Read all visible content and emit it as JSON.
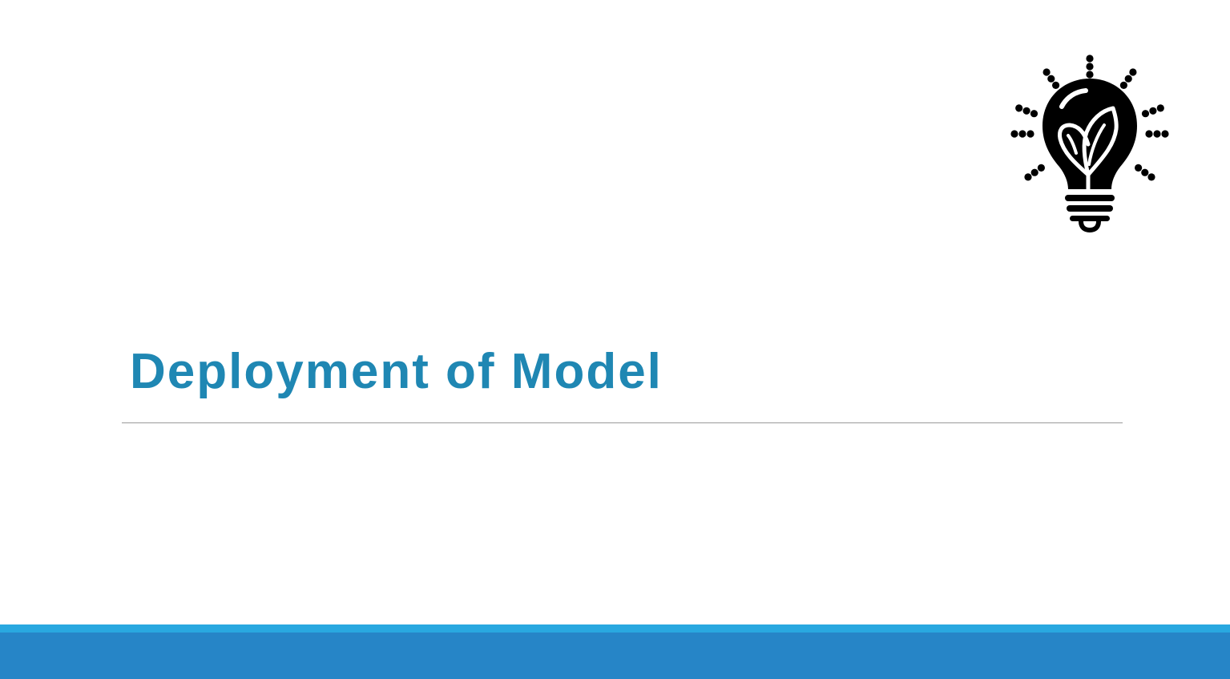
{
  "slide": {
    "title": "Deployment of Model"
  },
  "icons": {
    "illustration": "lightbulb-leaf-icon"
  },
  "colors": {
    "title": "#1f87b3",
    "band_light": "#29a8e0",
    "band_dark": "#2685c7",
    "icon": "#000000",
    "divider": "#9a9a9a"
  }
}
